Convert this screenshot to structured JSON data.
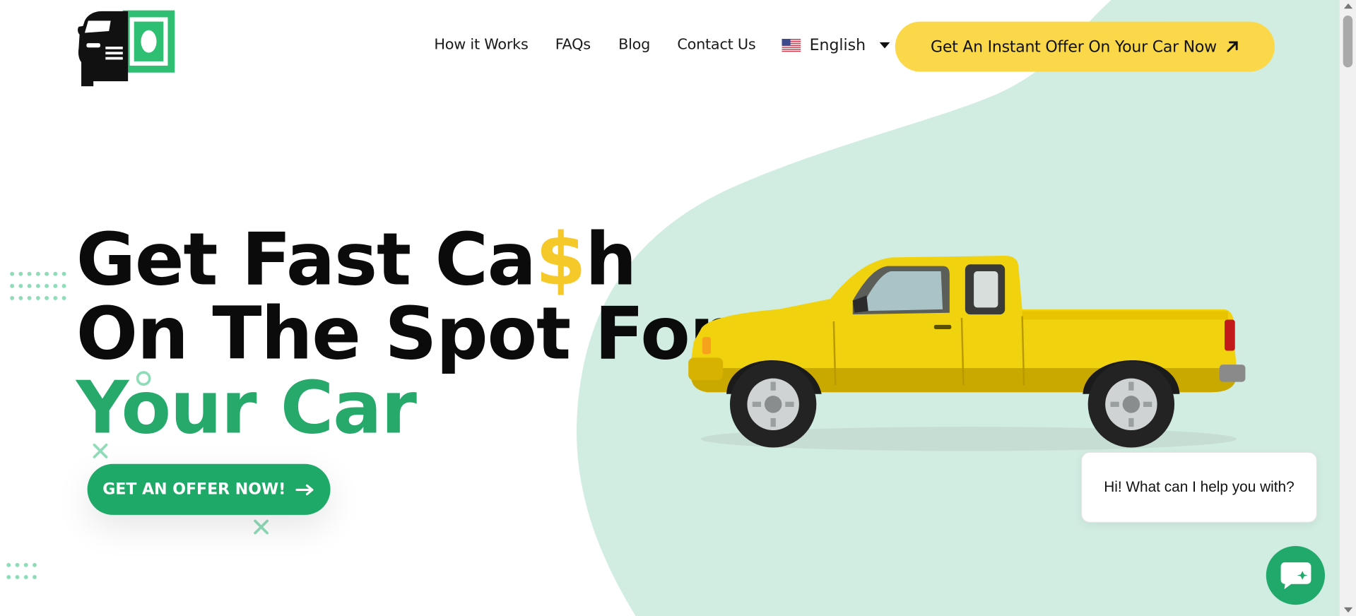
{
  "header": {
    "nav": [
      {
        "label": "How it Works"
      },
      {
        "label": "FAQs"
      },
      {
        "label": "Blog"
      },
      {
        "label": "Contact Us"
      }
    ],
    "language": {
      "label": "English",
      "flag_icon": "us-flag-icon"
    },
    "cta_label": "Get An Instant Offer On Your Car Now",
    "cta_icon": "arrow-up-right-icon"
  },
  "hero": {
    "line1_prefix": "Get Fast Ca",
    "line1_dollar": "$",
    "line1_suffix": "h",
    "line2": "On The Spot For",
    "line3": "Your Car",
    "cta_label": "GET AN OFFER NOW!",
    "cta_icon": "arrow-right-icon"
  },
  "chat": {
    "message": "Hi! What can I help you with?",
    "launcher_icon": "chat-bubble-icon"
  },
  "colors": {
    "accent_yellow": "#fbd84a",
    "brand_green": "#1fa968",
    "mint_background": "#d1ede2",
    "heading_dark": "#0b0b0b"
  }
}
